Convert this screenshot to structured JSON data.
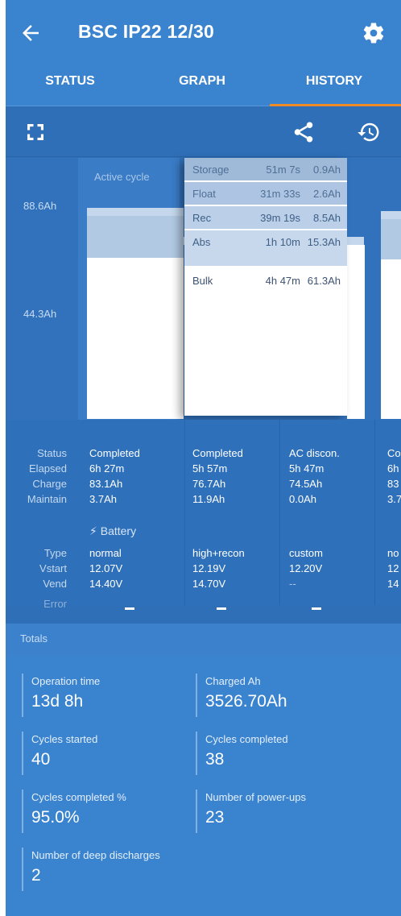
{
  "appbar": {
    "title": "BSC IP22 12/30",
    "back_icon": "arrow-left-icon",
    "settings_icon": "gear-icon"
  },
  "tabs": [
    {
      "label": "STATUS"
    },
    {
      "label": "GRAPH"
    },
    {
      "label": "HISTORY",
      "selected": true
    }
  ],
  "toolbar": {
    "fullscreen_icon": "fullscreen-icon",
    "share_icon": "share-icon",
    "history_icon": "history-restore-icon"
  },
  "chart": {
    "y_ticks": [
      "88.6Ah",
      "44.3Ah"
    ],
    "active_cycle_label": "Active cycle",
    "tooltip": [
      {
        "phase": "Storage",
        "time": "51m 7s",
        "ah": "0.9Ah"
      },
      {
        "phase": "Float",
        "time": "31m 33s",
        "ah": "2.6Ah"
      },
      {
        "phase": "Rec",
        "time": "39m 19s",
        "ah": "8.5Ah"
      },
      {
        "phase": "Abs",
        "time": "1h 10m",
        "ah": "15.3Ah"
      },
      {
        "phase": "Bulk",
        "time": "4h 47m",
        "ah": "61.3Ah"
      }
    ]
  },
  "table": {
    "row_labels": {
      "status": "Status",
      "elapsed": "Elapsed",
      "charge": "Charge",
      "maintain": "Maintain",
      "type": "Type",
      "vstart": "Vstart",
      "vend": "Vend",
      "error": "Error"
    },
    "battery_header": "Battery",
    "cycles": [
      {
        "status": "Completed",
        "elapsed": "6h 27m",
        "charge": "83.1Ah",
        "maintain": "3.7Ah",
        "type": "normal",
        "vstart": "12.07V",
        "vend": "14.40V"
      },
      {
        "status": "Completed",
        "elapsed": "5h 57m",
        "charge": "76.7Ah",
        "maintain": "11.9Ah",
        "type": "high+recon",
        "vstart": "12.19V",
        "vend": "14.70V"
      },
      {
        "status": "AC discon.",
        "elapsed": "5h 47m",
        "charge": "74.5Ah",
        "maintain": "0.0Ah",
        "type": "custom",
        "vstart": "12.20V",
        "vend": "--"
      },
      {
        "status": "Co",
        "elapsed": "6h",
        "charge": "83",
        "maintain": "3.7",
        "type": "no",
        "vstart": "12",
        "vend": "14"
      }
    ]
  },
  "totals": {
    "title": "Totals",
    "stats": [
      {
        "label": "Operation time",
        "value": "13d 8h"
      },
      {
        "label": "Charged Ah",
        "value": "3526.70Ah"
      },
      {
        "label": "Cycles started",
        "value": "40"
      },
      {
        "label": "Cycles completed",
        "value": "38"
      },
      {
        "label": "Cycles completed %",
        "value": "95.0%"
      },
      {
        "label": "Number of power-ups",
        "value": "23"
      },
      {
        "label": "Number of deep discharges",
        "value": "2"
      }
    ]
  }
}
